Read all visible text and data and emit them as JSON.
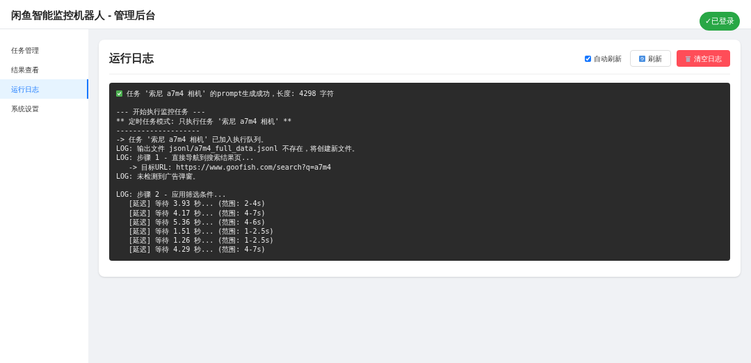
{
  "header": {
    "title": "闲鱼智能监控机器人 - 管理后台",
    "status_badge": "✓已登录"
  },
  "sidebar": {
    "items": [
      {
        "label": "任务管理",
        "selected": false
      },
      {
        "label": "结果查看",
        "selected": false
      },
      {
        "label": "运行日志",
        "selected": true
      },
      {
        "label": "系统设置",
        "selected": false
      }
    ]
  },
  "panel": {
    "title": "运行日志",
    "auto_refresh": {
      "label": "自动刷新",
      "checked": true
    },
    "refresh_button": "刷新",
    "clear_button": "清空日志",
    "log_lines": [
      {
        "kind": "success",
        "text": "任务 '索尼 a7m4 相机' 的prompt生成成功，长度: 4298 字符"
      },
      {
        "kind": "blank"
      },
      {
        "kind": "text",
        "text": "--- 开始执行监控任务 ---"
      },
      {
        "kind": "text",
        "text": "** 定时任务模式: 只执行任务 '索尼 a7m4 相机' **"
      },
      {
        "kind": "text",
        "text": "--------------------"
      },
      {
        "kind": "text",
        "text": "-> 任务 '索尼 a7m4 相机' 已加入执行队列。"
      },
      {
        "kind": "text",
        "text": "LOG: 输出文件 jsonl/a7m4_full_data.jsonl 不存在，将创建新文件。"
      },
      {
        "kind": "text",
        "text": "LOG: 步骤 1 - 直接导航到搜索结果页..."
      },
      {
        "kind": "text",
        "text": "   -> 目标URL: https://www.goofish.com/search?q=a7m4"
      },
      {
        "kind": "text",
        "text": "LOG: 未检测到广告弹窗。"
      },
      {
        "kind": "blank"
      },
      {
        "kind": "text",
        "text": "LOG: 步骤 2 - 应用筛选条件..."
      },
      {
        "kind": "text",
        "text": "   [延迟] 等待 3.93 秒... (范围: 2-4s)"
      },
      {
        "kind": "text",
        "text": "   [延迟] 等待 4.17 秒... (范围: 4-7s)"
      },
      {
        "kind": "text",
        "text": "   [延迟] 等待 5.36 秒... (范围: 4-6s)"
      },
      {
        "kind": "text",
        "text": "   [延迟] 等待 1.51 秒... (范围: 1-2.5s)"
      },
      {
        "kind": "text",
        "text": "   [延迟] 等待 1.26 秒... (范围: 1-2.5s)"
      },
      {
        "kind": "text",
        "text": "   [延迟] 等待 4.29 秒... (范围: 4-7s)"
      }
    ]
  }
}
